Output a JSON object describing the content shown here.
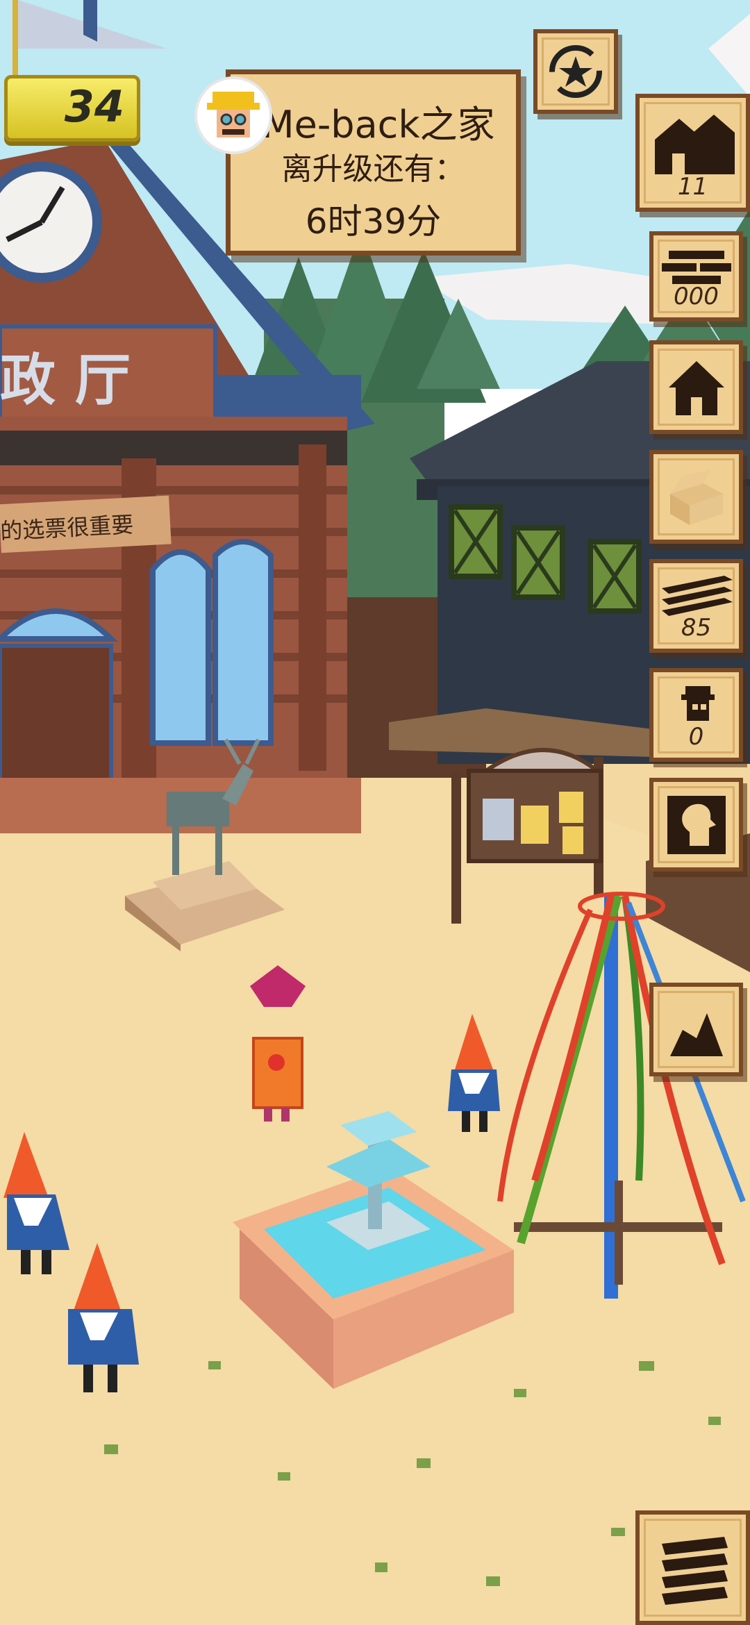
{
  "hud": {
    "player_level": "34",
    "town_info": {
      "title": "Me-back之家",
      "subtitle": "离升级还有：",
      "timer": "6时39分"
    },
    "side_items": [
      {
        "icon": "houses-icon",
        "count": "11"
      },
      {
        "icon": "bricks-icon",
        "count": "000"
      },
      {
        "icon": "house-icon",
        "count": ""
      },
      {
        "icon": "box-icon",
        "count": ""
      },
      {
        "icon": "planks-icon",
        "count": "85"
      },
      {
        "icon": "villager-icon",
        "count": "0"
      },
      {
        "icon": "portrait-icon",
        "count": ""
      },
      {
        "icon": "map-icon",
        "count": ""
      }
    ]
  },
  "scene": {
    "town_hall_sign": "政 厅",
    "banner_text": "的选票很重要"
  },
  "colors": {
    "sky": "#bfe9f3",
    "ground": "#f3d8a1",
    "panel_bg": "#f0cf93",
    "panel_border": "#7a4a25",
    "level_badge": "#e8dc45",
    "fountain_water": "#5fd6ea"
  }
}
